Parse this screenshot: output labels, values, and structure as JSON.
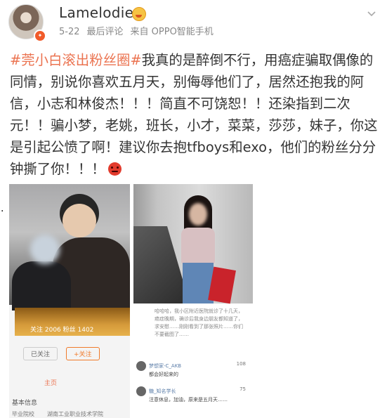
{
  "post": {
    "username": "Lamelodie",
    "date": "5-22",
    "action": "最后评论",
    "source": "来自 OPPO智能手机",
    "hashtag": "#莞小白滚出粉丝圈#",
    "body": "我真的是醉倒不行，用癌症骗取偶像的同情，别说你喜欢五月天，别侮辱他们了，居然还抱我的阿信，小志和林俊杰！！！简直不可饶恕！！还染指到二次元！！骗小梦，老姚，班长，小才，菜菜，莎莎，妹子，你这是引起公愤了啊！建议你去抱tfboys和exo，他们的粉丝分分钟撕了你！！！",
    "avatar_badge": "✦",
    "stray_mark": "."
  },
  "icons": {
    "vip": "vip-icon",
    "angry": "angry-face-icon",
    "chevron": "chevron-down-icon"
  },
  "colors": {
    "hashtag": "#eb7350",
    "meta": "#888888"
  },
  "left_image": {
    "stats": "关注 2006    粉丝 1402",
    "buttons": [
      "已关注",
      "+关注"
    ],
    "tab": "主页",
    "info_title": "基本信息",
    "info_label": "毕业院校",
    "info_value": "湖南工业职业技术学院"
  },
  "right_image": {
    "caption": "哈哈哈，我小区附近医院就诊了十几天，癌症晚期，确诊后我身边朋友都知道了，求安慰……刚刚看到了那张照片……你们不要截图了……",
    "comments": [
      {
        "name": "梦想家-C_AKB",
        "likes": "108",
        "body": "都会好起来的"
      },
      {
        "name": "糖_知名学长",
        "likes": "75",
        "body": "注意休息，加油，原来是五月天……"
      }
    ]
  }
}
